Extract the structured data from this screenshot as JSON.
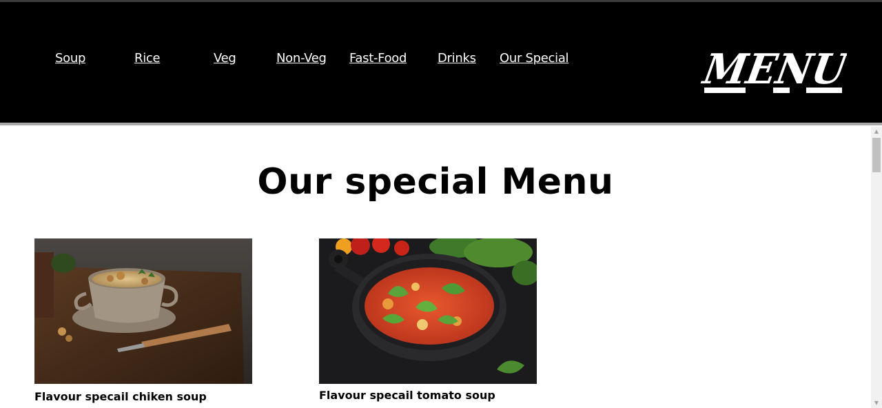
{
  "nav": {
    "items": [
      {
        "label": "Soup"
      },
      {
        "label": "Rice"
      },
      {
        "label": "Veg"
      },
      {
        "label": "Non-Veg"
      },
      {
        "label": "Fast-Food"
      },
      {
        "label": "Drinks"
      },
      {
        "label": "Our Special"
      }
    ]
  },
  "logo": {
    "text": "MENU"
  },
  "main": {
    "title": "Our special Menu",
    "cards": [
      {
        "caption": "Flavour specail chiken soup"
      },
      {
        "caption": "Flavour specail tomato soup"
      }
    ]
  },
  "colors": {
    "header_bg": "#000000",
    "nav_text": "#ffffff",
    "page_bg": "#ffffff"
  },
  "icons": {
    "scroll_up": "scroll-up-arrow-icon",
    "scroll_down": "scroll-down-arrow-icon"
  }
}
